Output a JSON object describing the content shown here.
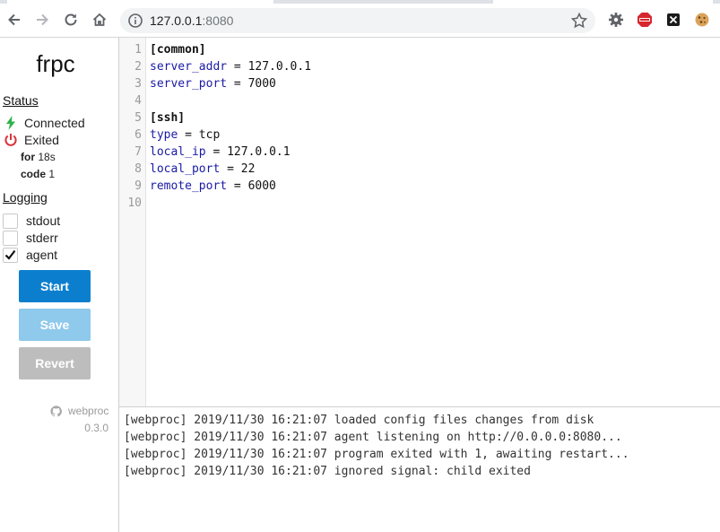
{
  "browser": {
    "url_host": "127.0.0.1",
    "url_port": ":8080"
  },
  "sidebar": {
    "brand": "frpc",
    "status_title": "Status",
    "status": [
      {
        "label": "Connected",
        "icon": "lightning-icon",
        "color": "#2db34a"
      },
      {
        "label": "Exited",
        "icon": "power-icon",
        "color": "#d9343a"
      }
    ],
    "details": [
      {
        "key": "for",
        "value": "18s"
      },
      {
        "key": "code",
        "value": "1"
      }
    ],
    "logging_title": "Logging",
    "logging": [
      {
        "label": "stdout",
        "checked": false
      },
      {
        "label": "stderr",
        "checked": false
      },
      {
        "label": "agent",
        "checked": true
      }
    ],
    "buttons": {
      "start": "Start",
      "save": "Save",
      "revert": "Revert"
    },
    "credit": "webproc",
    "version": "0.3.0"
  },
  "editor": {
    "line_numbers": [
      "1",
      "2",
      "3",
      "4",
      "5",
      "6",
      "7",
      "8",
      "9",
      "10"
    ],
    "lines": [
      {
        "kind": "section",
        "text": "[common]"
      },
      {
        "kind": "kv",
        "key": "server_addr",
        "value": "127.0.0.1"
      },
      {
        "kind": "kv",
        "key": "server_port",
        "value": "7000"
      },
      {
        "kind": "blank"
      },
      {
        "kind": "section",
        "text": "[ssh]"
      },
      {
        "kind": "kv",
        "key": "type",
        "value": "tcp"
      },
      {
        "kind": "kv",
        "key": "local_ip",
        "value": "127.0.0.1"
      },
      {
        "kind": "kv",
        "key": "local_port",
        "value": "22"
      },
      {
        "kind": "kv",
        "key": "remote_port",
        "value": "6000"
      },
      {
        "kind": "blank"
      }
    ]
  },
  "log": [
    "[webproc] 2019/11/30 16:21:07 loaded config files changes from disk",
    "[webproc] 2019/11/30 16:21:07 agent listening on http://0.0.0.0:8080...",
    "[webproc] 2019/11/30 16:21:07 program exited with 1, awaiting restart...",
    "[webproc] 2019/11/30 16:21:07 ignored signal: child exited"
  ],
  "colors": {
    "accent": "#0b7fce",
    "key": "#1a1aa6"
  }
}
